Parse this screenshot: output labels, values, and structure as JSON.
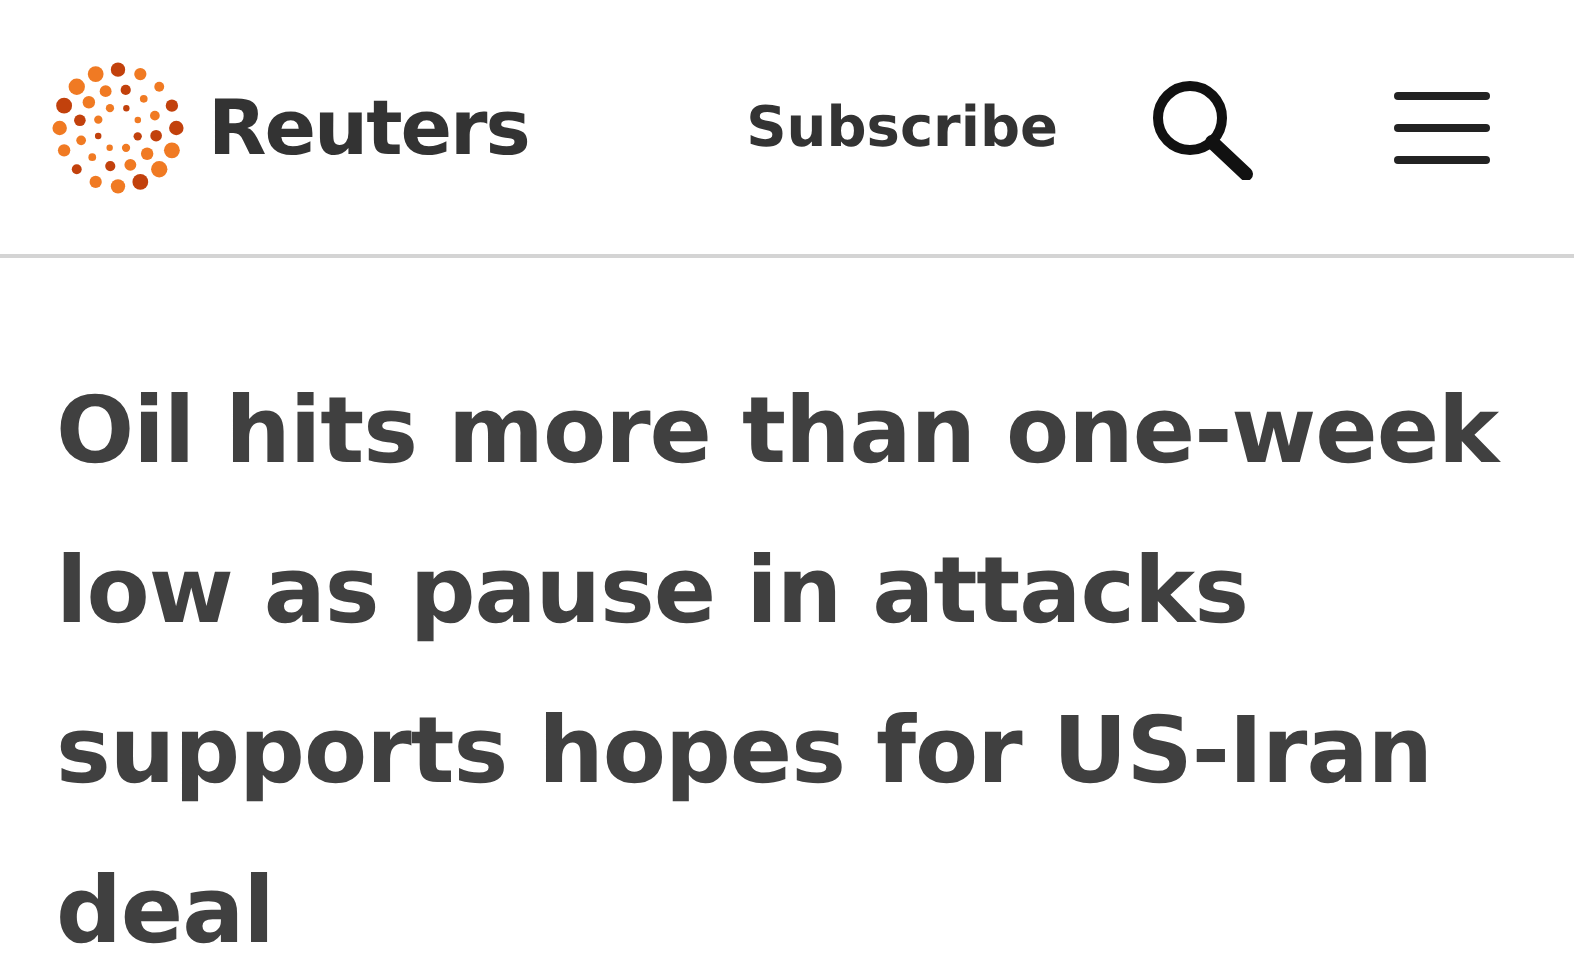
{
  "header": {
    "brand": "Reuters",
    "subscribe": "Subscribe"
  },
  "headline": "Oil hits more than one-week low as pause in attacks supports hopes for US-Iran deal"
}
